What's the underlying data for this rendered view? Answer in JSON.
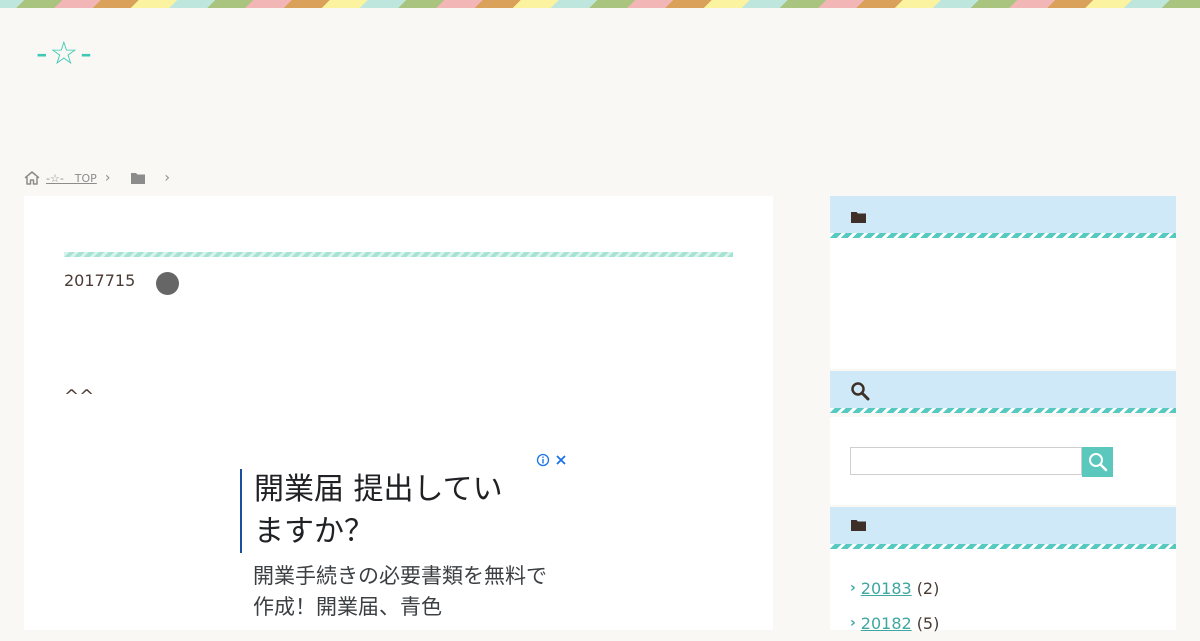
{
  "header": {
    "logo_text": "-☆-"
  },
  "breadcrumb": {
    "home_label": "-☆-　TOP"
  },
  "article": {
    "date": "2017715",
    "body_text": "^^"
  },
  "ad": {
    "headline": "開業届 提出していますか？",
    "body": "開業手続きの必要書類を無料で作成！開業届、青色"
  },
  "sidebar": {
    "search": {
      "value": "",
      "placeholder": ""
    },
    "archives": [
      {
        "label": "20183",
        "count": "(2)"
      },
      {
        "label": "20182",
        "count": "(5)"
      }
    ]
  },
  "colors": {
    "accent": "#3fc8b5",
    "widget_header": "#cfe9f8",
    "search_button": "#5cc7bc",
    "link": "#3fa79f"
  },
  "icons": [
    "home-icon",
    "folder-icon",
    "chevron-right-icon",
    "search-icon",
    "ad-info-icon",
    "ad-close-icon"
  ]
}
